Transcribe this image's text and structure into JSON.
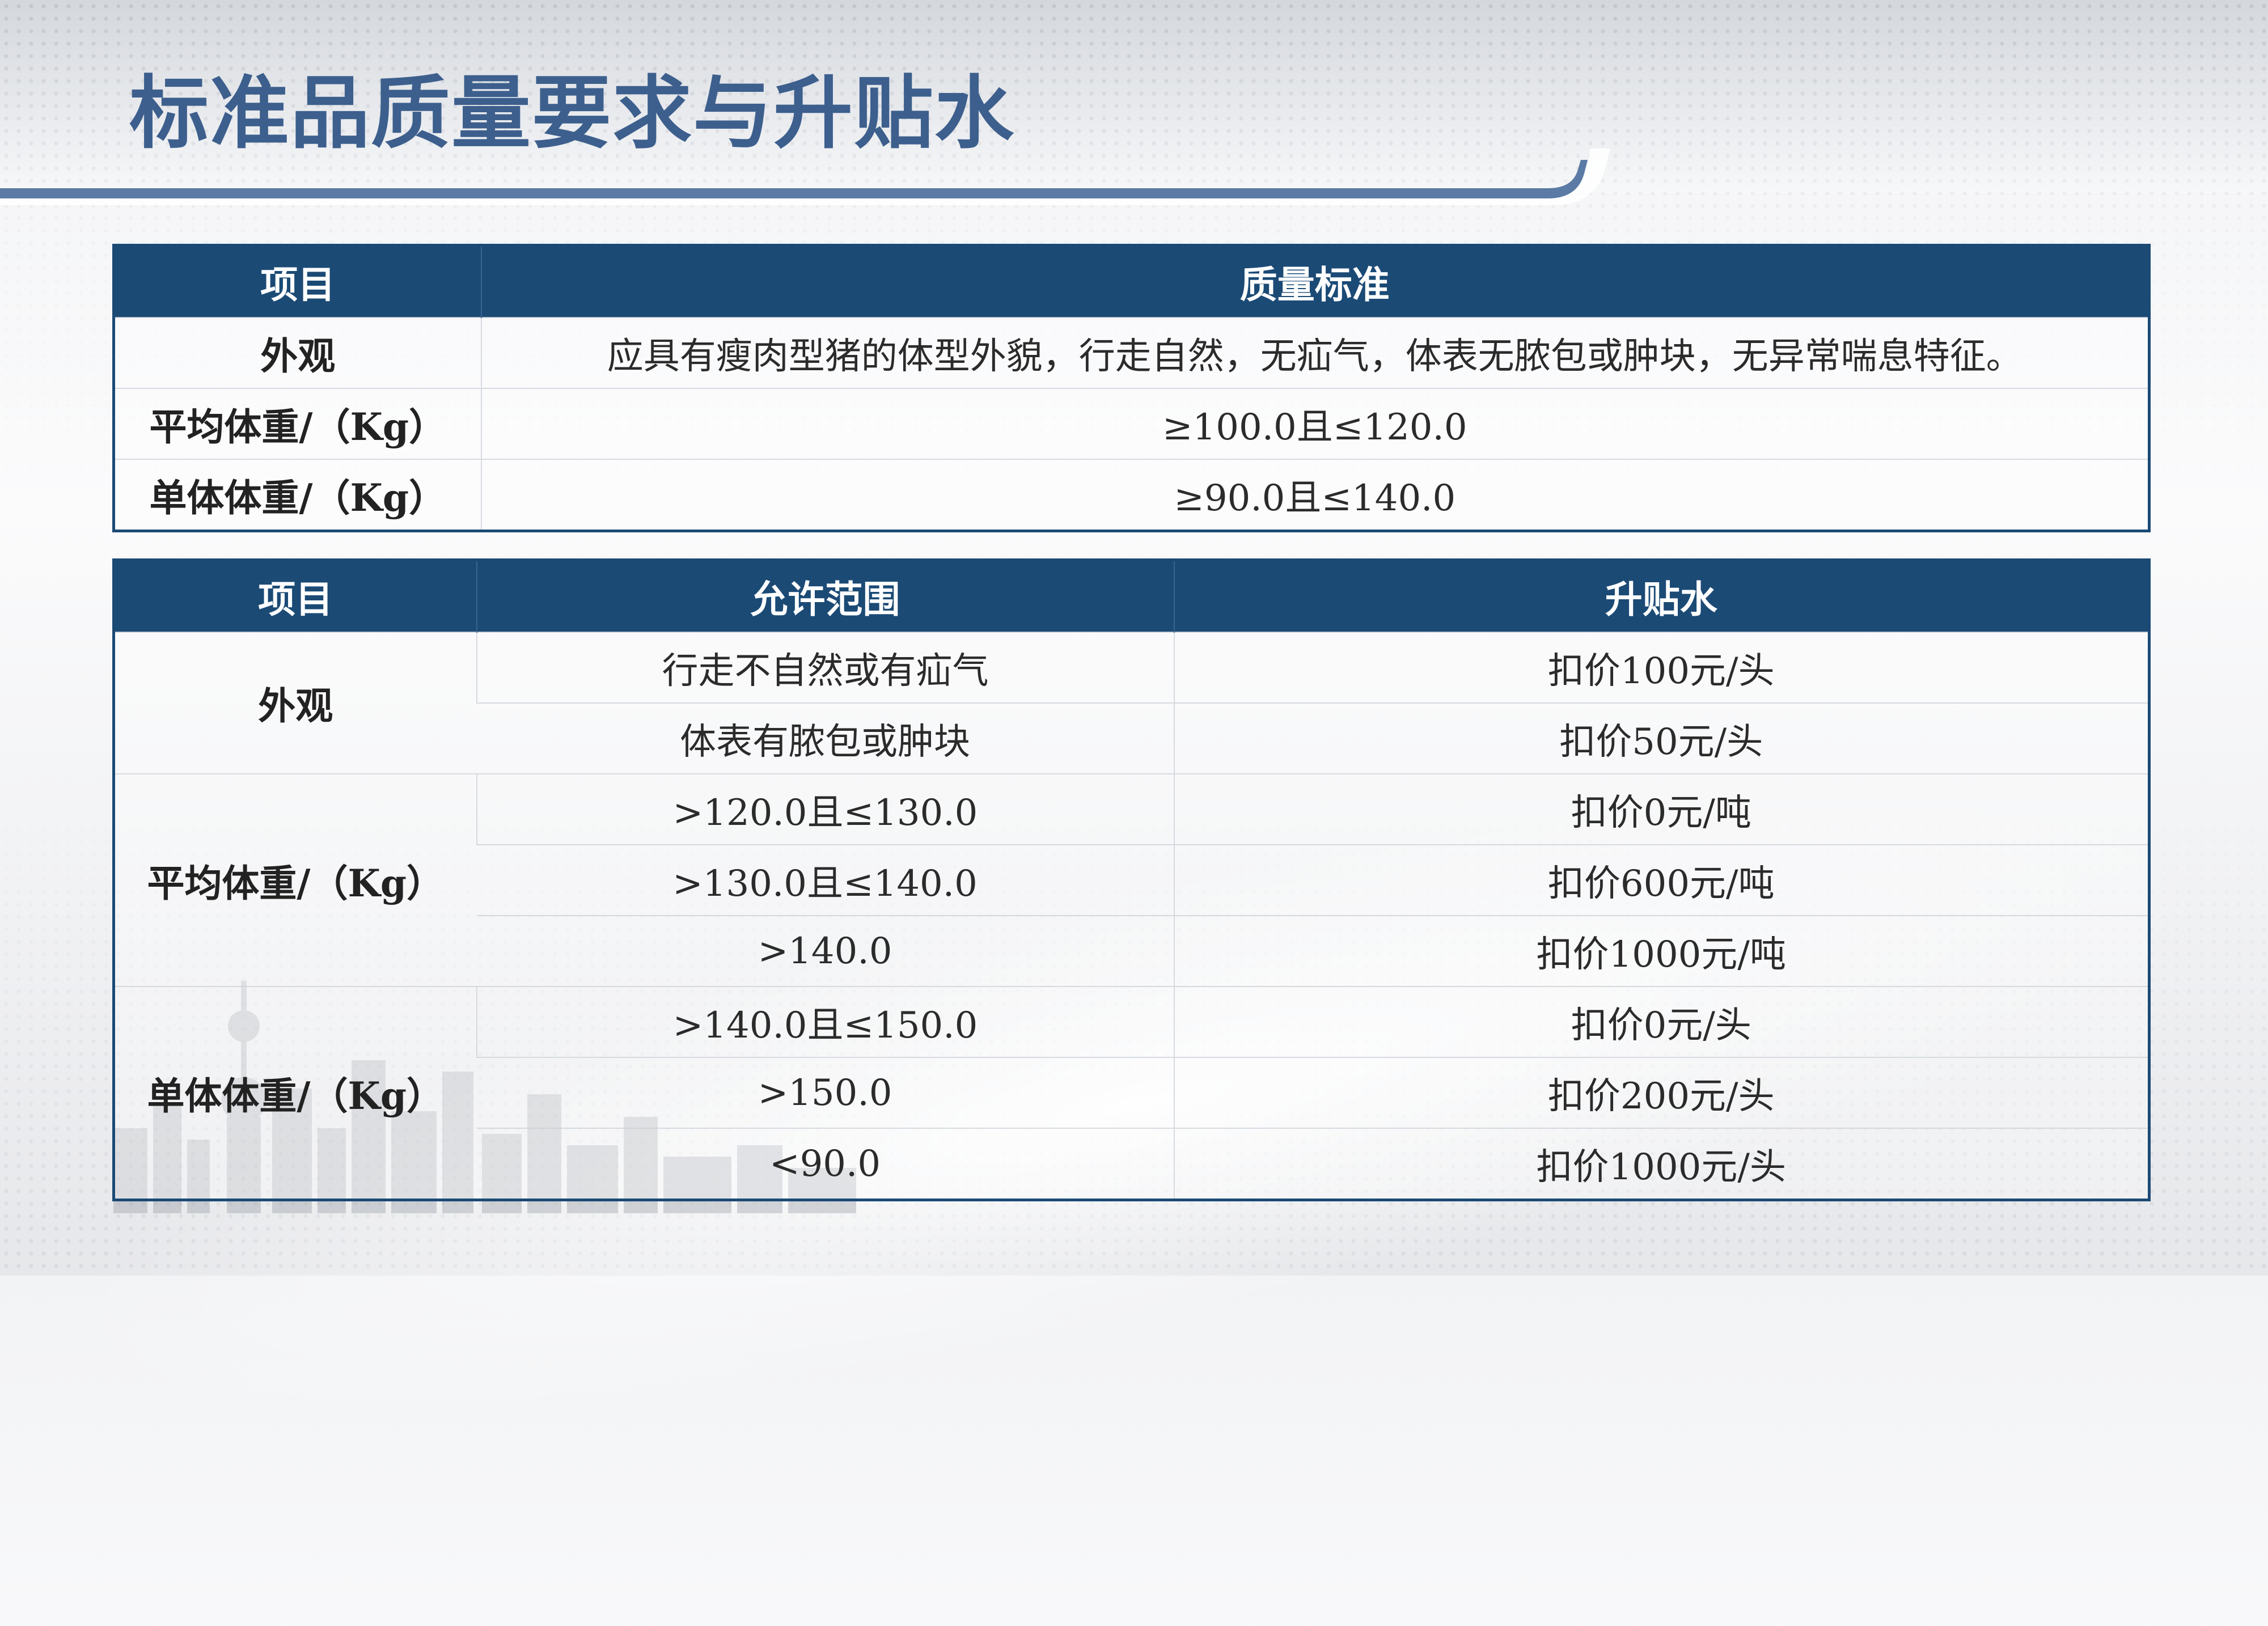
{
  "title": "标准品质量要求与升贴水",
  "table1": {
    "headers": [
      "项目",
      "质量标准"
    ],
    "rows": [
      {
        "item": "外观",
        "value": "应具有瘦肉型猪的体型外貌，行走自然，无疝气，体表无脓包或肿块，无异常喘息特征。"
      },
      {
        "item": "平均体重/（Kg）",
        "value": "≥100.0且≤120.0"
      },
      {
        "item": "单体体重/（Kg）",
        "value": "≥90.0且≤140.0"
      }
    ]
  },
  "table2": {
    "headers": [
      "项目",
      "允许范围",
      "升贴水"
    ],
    "groups": [
      {
        "item": "外观",
        "rows": [
          {
            "range": "行走不自然或有疝气",
            "adjust": "扣价100元/头"
          },
          {
            "range": "体表有脓包或肿块",
            "adjust": "扣价50元/头"
          }
        ]
      },
      {
        "item": "平均体重/（Kg）",
        "rows": [
          {
            "range": ">120.0且≤130.0",
            "adjust": "扣价0元/吨"
          },
          {
            "range": ">130.0且≤140.0",
            "adjust": "扣价600元/吨"
          },
          {
            "range": ">140.0",
            "adjust": "扣价1000元/吨"
          }
        ]
      },
      {
        "item": "单体体重/（Kg）",
        "rows": [
          {
            "range": ">140.0且≤150.0",
            "adjust": "扣价0元/头"
          },
          {
            "range": ">150.0",
            "adjust": "扣价200元/头"
          },
          {
            "range": "<90.0",
            "adjust": "扣价1000元/头"
          }
        ]
      }
    ]
  },
  "colors": {
    "header_fill": "#1b4a75",
    "title": "#3d5f8d"
  }
}
